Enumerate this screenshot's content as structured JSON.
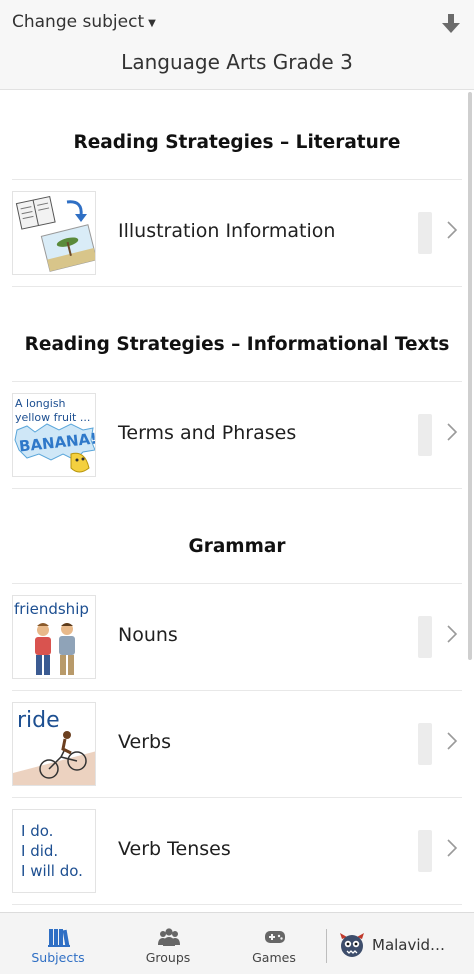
{
  "header": {
    "change_subject": "Change subject",
    "title": "Language Arts Grade 3"
  },
  "sections": [
    {
      "title": "Reading Strategies – Literature",
      "items": [
        {
          "label": "Illustration Information",
          "thumb_text": []
        }
      ]
    },
    {
      "title": "Reading Strategies – Informational Texts",
      "items": [
        {
          "label": "Terms and Phrases",
          "thumb_text": [
            "A longish",
            "yellow fruit ...",
            "BANANA!"
          ]
        }
      ]
    },
    {
      "title": "Grammar",
      "items": [
        {
          "label": "Nouns",
          "thumb_text": [
            "friendship"
          ]
        },
        {
          "label": "Verbs",
          "thumb_text": [
            "ride"
          ]
        },
        {
          "label": "Verb Tenses",
          "thumb_text": [
            "I do.",
            "I did.",
            "I will do."
          ]
        }
      ]
    }
  ],
  "tabbar": {
    "tabs": [
      {
        "label": "Subjects",
        "icon": "books-icon",
        "active": true
      },
      {
        "label": "Groups",
        "icon": "people-icon",
        "active": false
      },
      {
        "label": "Games",
        "icon": "gamepad-icon",
        "active": false
      }
    ],
    "profile_name": "Malavid…"
  },
  "colors": {
    "accent": "#2f6fc4",
    "thumb_text_blue": "#1d4f91",
    "header_bg": "#f7f7f7"
  }
}
